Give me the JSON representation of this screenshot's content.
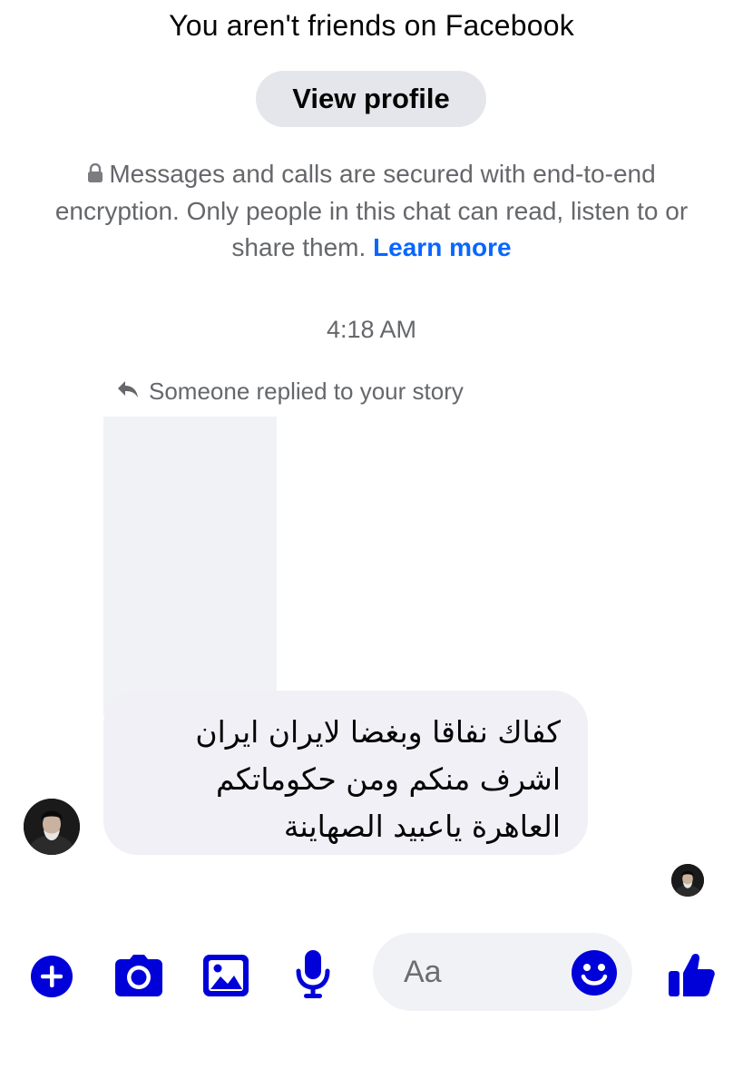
{
  "header": {
    "title": "You aren't friends on Facebook",
    "view_profile_label": "View profile"
  },
  "encryption_notice": {
    "text": "Messages and calls are secured with end-to-end encryption. Only people in this chat can read, listen to or share them.",
    "link_label": "Learn more"
  },
  "conversation": {
    "timestamp": "4:18 AM",
    "reply_note": "Someone replied to your story",
    "message_text": "كفاك نفاقا وبغضا لايران ايران\nاشرف منكم ومن حكوماتكم\nالعاهرة ياعبيد الصهاينة"
  },
  "composer": {
    "placeholder": "Aa"
  },
  "colors": {
    "accent": "#0000d9",
    "link": "#0866ff",
    "secondary_text": "#65676b",
    "bubble": "#f0f0f6"
  },
  "icons": [
    "lock-icon",
    "reply-arrow-icon",
    "plus-icon",
    "camera-icon",
    "gallery-icon",
    "microphone-icon",
    "emoji-icon",
    "thumbs-up-icon"
  ]
}
